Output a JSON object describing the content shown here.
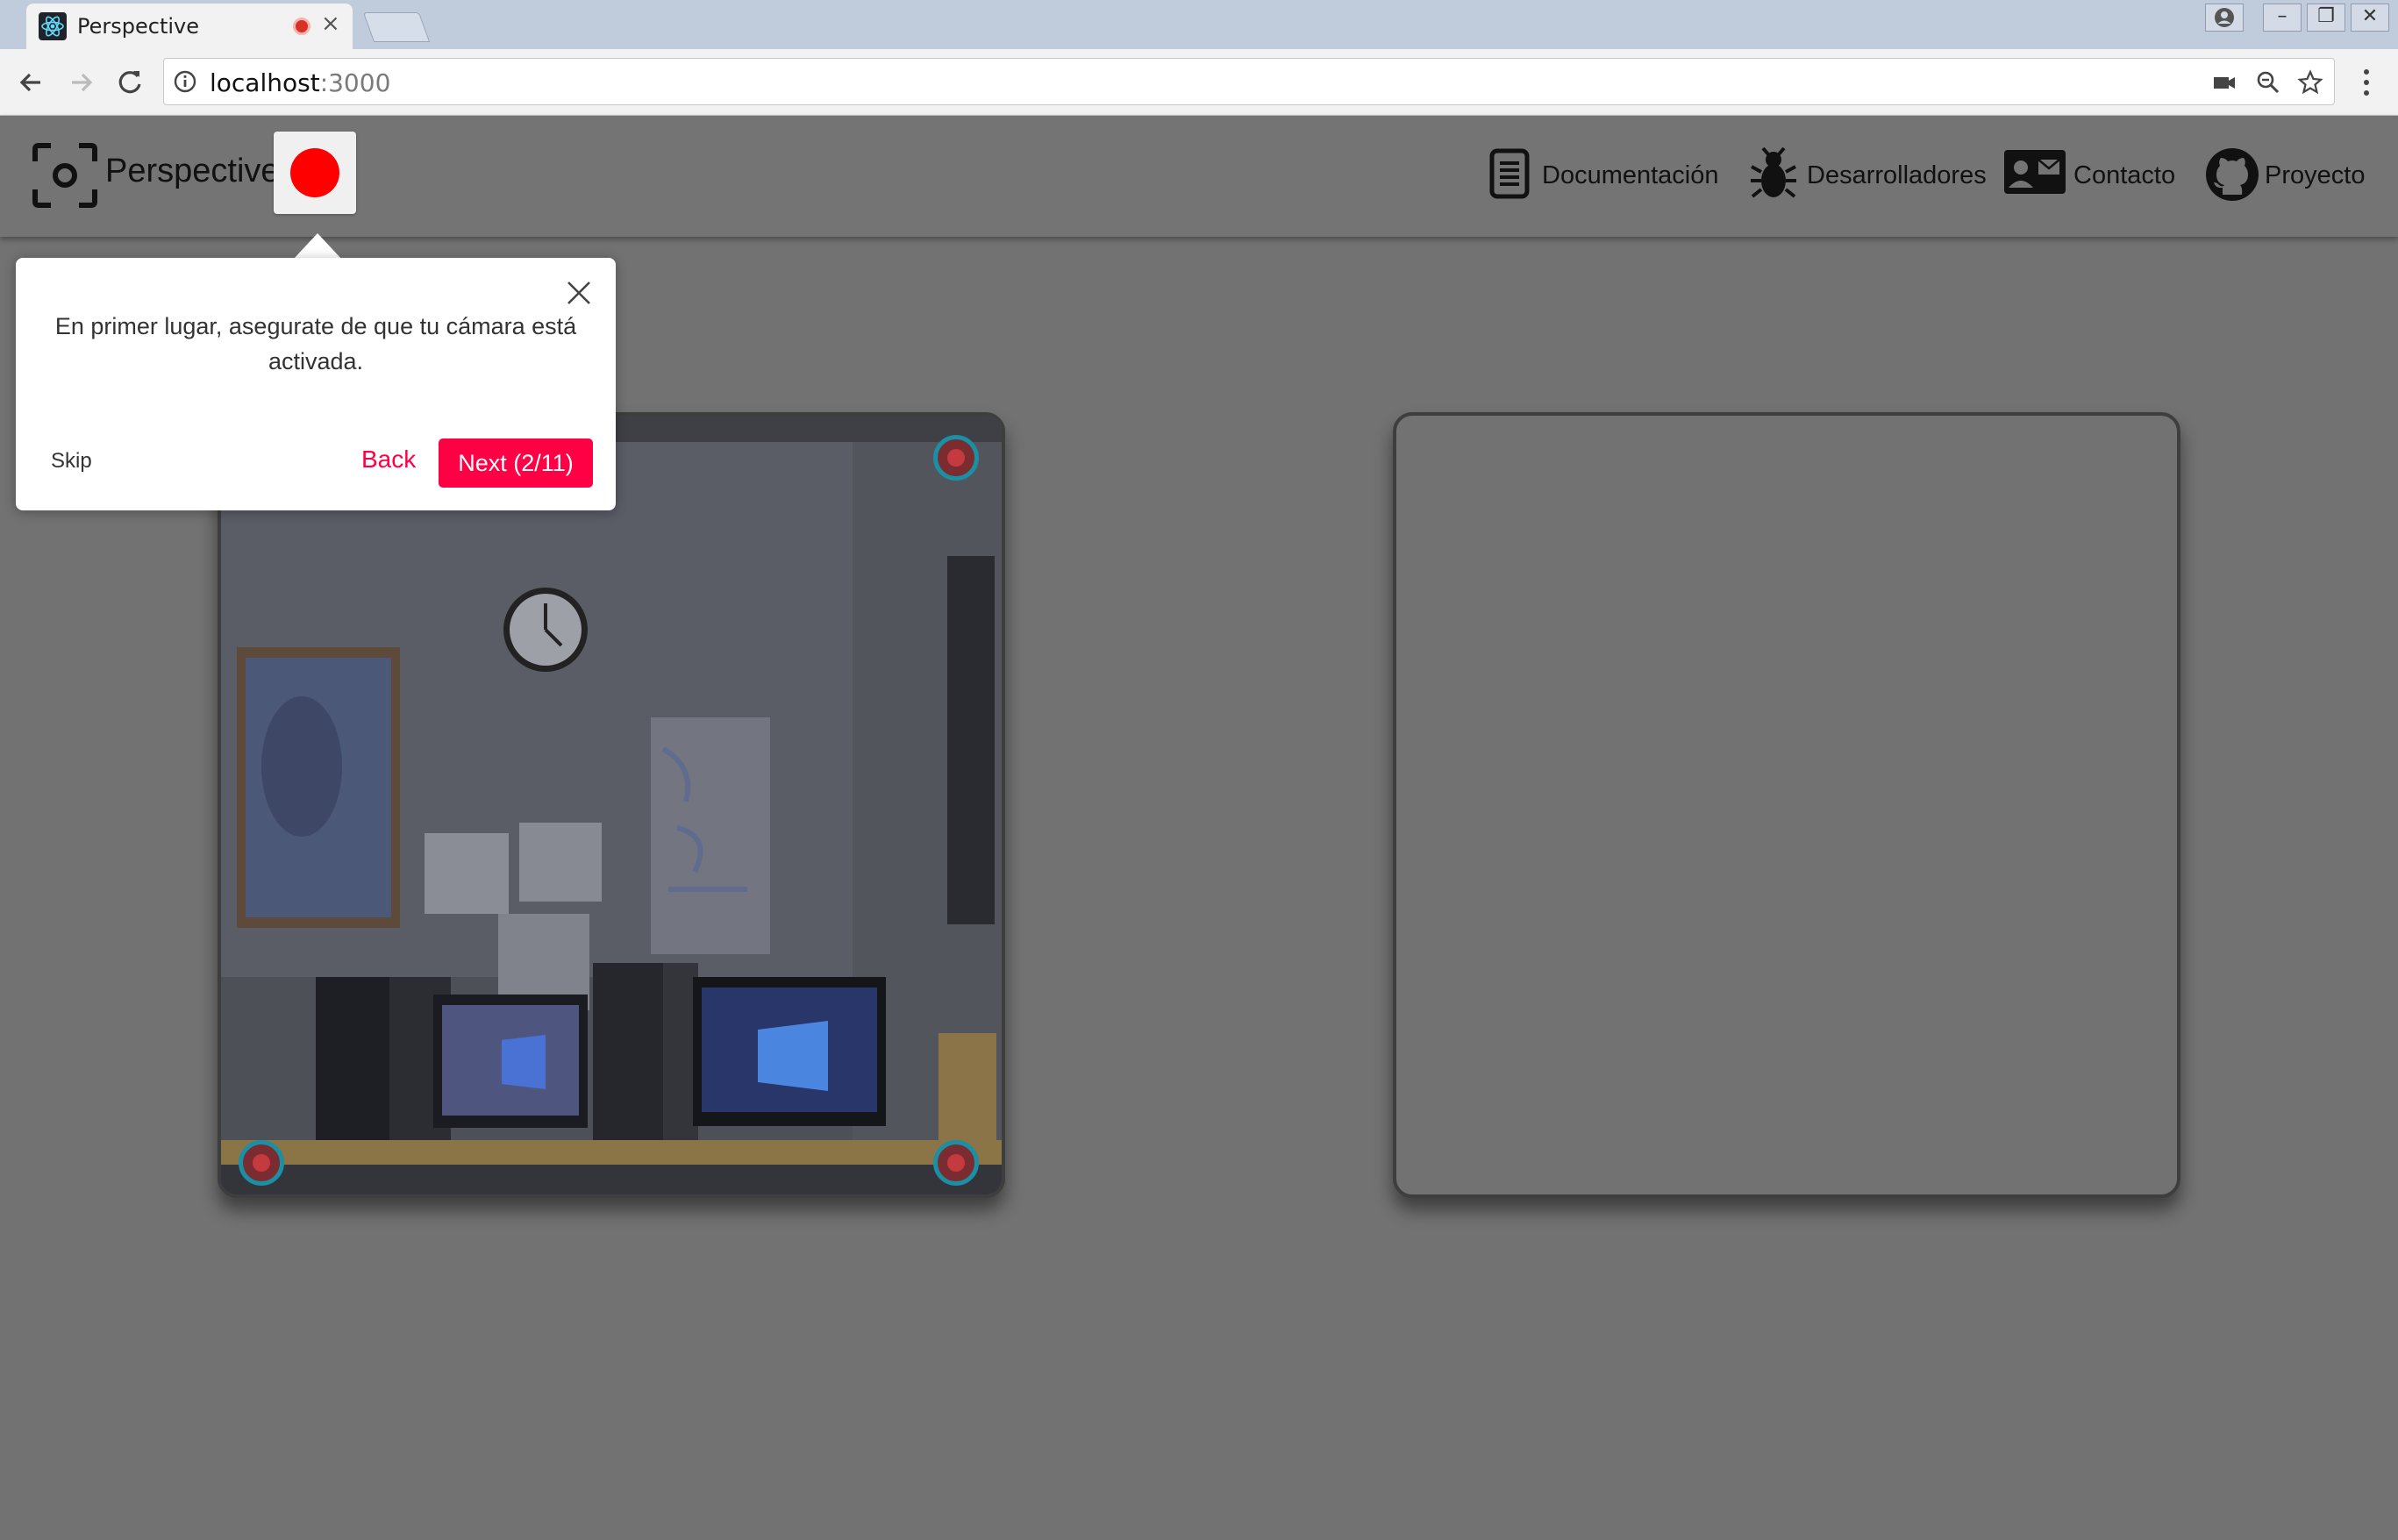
{
  "browser": {
    "tab_title": "Perspective",
    "tab_close": "×",
    "url_host": "localhost",
    "url_port": ":3000",
    "window_controls": {
      "minimize": "–",
      "restore": "❐",
      "close": "✕"
    }
  },
  "app": {
    "brand": "Perspective",
    "record_color": "#ff0000",
    "nav": [
      {
        "label": "Documentación",
        "icon": "document-icon"
      },
      {
        "label": "Desarrolladores",
        "icon": "bug-icon"
      },
      {
        "label": "Contacto",
        "icon": "contact-card-icon"
      },
      {
        "label": "Proyecto",
        "icon": "github-icon"
      }
    ]
  },
  "tour": {
    "text": "En primer lugar, asegurate de que tu cámara está activada.",
    "skip": "Skip",
    "back": "Back",
    "next": "Next (2/11)",
    "accent": "#ff0044"
  }
}
